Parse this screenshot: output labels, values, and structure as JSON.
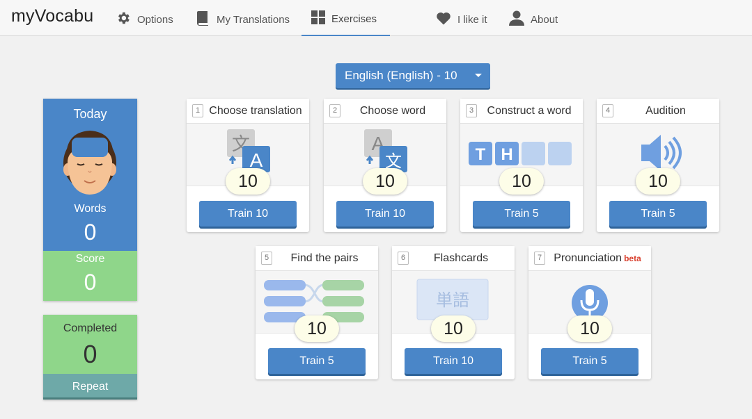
{
  "app": {
    "title": "myVocabu"
  },
  "nav": [
    {
      "label": "Options",
      "icon": "gear-icon"
    },
    {
      "label": "My Translations",
      "icon": "book-icon"
    },
    {
      "label": "Exercises",
      "icon": "grid-icon",
      "active": true
    },
    {
      "label": "I like it",
      "icon": "heart-icon"
    },
    {
      "label": "About",
      "icon": "person-icon"
    }
  ],
  "language_select": {
    "value": "English (English) - 10"
  },
  "stats": {
    "today": "Today",
    "words_label": "Words",
    "words_value": "0",
    "score_label": "Score",
    "score_value": "0"
  },
  "completed": {
    "label": "Completed",
    "value": "0",
    "repeat_label": "Repeat"
  },
  "exercises": [
    {
      "num": "1",
      "title": "Choose translation",
      "count": "10",
      "button": "Train 10",
      "icon": "translate-icon"
    },
    {
      "num": "2",
      "title": "Choose word",
      "count": "10",
      "button": "Train 10",
      "icon": "translate-reverse-icon"
    },
    {
      "num": "3",
      "title": "Construct a word",
      "count": "10",
      "button": "Train 5",
      "icon": "letter-tiles-icon"
    },
    {
      "num": "4",
      "title": "Audition",
      "count": "10",
      "button": "Train 5",
      "icon": "speaker-icon"
    },
    {
      "num": "5",
      "title": "Find the pairs",
      "count": "10",
      "button": "Train 5",
      "icon": "pairs-icon"
    },
    {
      "num": "6",
      "title": "Flashcards",
      "count": "10",
      "button": "Train 10",
      "icon": "flashcard-icon",
      "art_text": "単語"
    },
    {
      "num": "7",
      "title": "Pronunciation",
      "badge": "beta",
      "count": "10",
      "button": "Train 5",
      "icon": "microphone-icon"
    }
  ],
  "tiles_letters": [
    "T",
    "H"
  ],
  "translate_glyphs": {
    "cjk": "文",
    "latin": "A"
  },
  "colors": {
    "accent": "#4a86c8",
    "green": "#8fd68a",
    "teal": "#6ea9a8",
    "beta": "#d9412f"
  }
}
